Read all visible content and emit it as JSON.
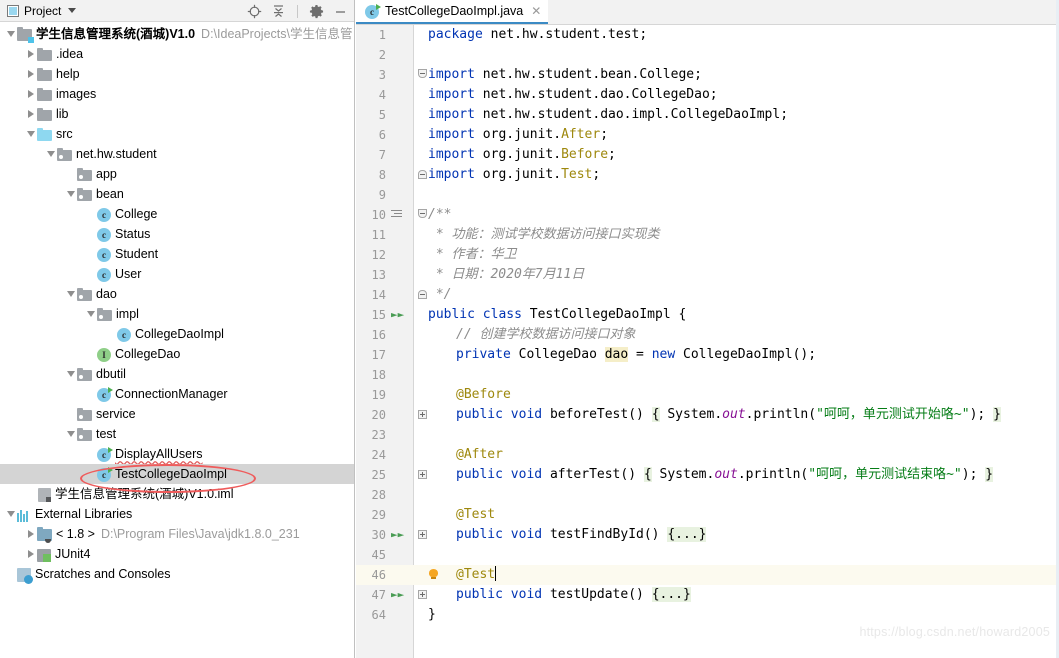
{
  "panel": {
    "title": "Project",
    "icons": [
      "project-icon",
      "chevron-down-icon",
      "locate-icon",
      "collapse-all-icon",
      "settings-gear-icon",
      "minimize-icon"
    ]
  },
  "tree": [
    {
      "label": "学生信息管理系统(酒城)V1.0",
      "sub": "D:\\IdeaProjects\\学生信息管",
      "indent": 0,
      "arrow": "open",
      "icon": "module-folder",
      "bold": true,
      "name": "tree-item-project-root"
    },
    {
      "label": ".idea",
      "indent": 1,
      "arrow": "closed",
      "icon": "folder",
      "name": "tree-item-idea"
    },
    {
      "label": "help",
      "indent": 1,
      "arrow": "closed",
      "icon": "folder",
      "name": "tree-item-help"
    },
    {
      "label": "images",
      "indent": 1,
      "arrow": "closed",
      "icon": "folder",
      "name": "tree-item-images"
    },
    {
      "label": "lib",
      "indent": 1,
      "arrow": "closed",
      "icon": "folder",
      "name": "tree-item-lib"
    },
    {
      "label": "src",
      "indent": 1,
      "arrow": "open",
      "icon": "source-folder",
      "name": "tree-item-src"
    },
    {
      "label": "net.hw.student",
      "indent": 2,
      "arrow": "open",
      "icon": "package",
      "name": "tree-item-package-net-hw-student"
    },
    {
      "label": "app",
      "indent": 3,
      "arrow": "none",
      "icon": "package",
      "name": "tree-item-package-app"
    },
    {
      "label": "bean",
      "indent": 3,
      "arrow": "open",
      "icon": "package",
      "name": "tree-item-package-bean"
    },
    {
      "label": "College",
      "indent": 4,
      "arrow": "none",
      "icon": "class",
      "name": "tree-item-class-college"
    },
    {
      "label": "Status",
      "indent": 4,
      "arrow": "none",
      "icon": "class",
      "name": "tree-item-class-status"
    },
    {
      "label": "Student",
      "indent": 4,
      "arrow": "none",
      "icon": "class",
      "name": "tree-item-class-student"
    },
    {
      "label": "User",
      "indent": 4,
      "arrow": "none",
      "icon": "class",
      "name": "tree-item-class-user"
    },
    {
      "label": "dao",
      "indent": 3,
      "arrow": "open",
      "icon": "package",
      "name": "tree-item-package-dao"
    },
    {
      "label": "impl",
      "indent": 4,
      "arrow": "open",
      "icon": "package",
      "name": "tree-item-package-impl"
    },
    {
      "label": "CollegeDaoImpl",
      "indent": 5,
      "arrow": "none",
      "icon": "class",
      "name": "tree-item-class-collegedaoimpl"
    },
    {
      "label": "CollegeDao",
      "indent": 4,
      "arrow": "none",
      "icon": "interface",
      "name": "tree-item-interface-collegedao"
    },
    {
      "label": "dbutil",
      "indent": 3,
      "arrow": "open",
      "icon": "package",
      "name": "tree-item-package-dbutil"
    },
    {
      "label": "ConnectionManager",
      "indent": 4,
      "arrow": "none",
      "icon": "class-runnable",
      "name": "tree-item-class-connectionmanager"
    },
    {
      "label": "service",
      "indent": 3,
      "arrow": "none",
      "icon": "package",
      "name": "tree-item-package-service"
    },
    {
      "label": "test",
      "indent": 3,
      "arrow": "open",
      "icon": "package",
      "name": "tree-item-package-test"
    },
    {
      "label": "DisplayAllUsers",
      "indent": 4,
      "arrow": "none",
      "icon": "class-runnable",
      "error": true,
      "name": "tree-item-class-displayallusers"
    },
    {
      "label": "TestCollegeDaoImpl",
      "indent": 4,
      "arrow": "none",
      "icon": "class-runnable",
      "selected": true,
      "name": "tree-item-class-testcollegedaoimpl"
    },
    {
      "label": "学生信息管理系统(酒城)V1.0.iml",
      "indent": 1,
      "arrow": "none",
      "icon": "iml",
      "name": "tree-item-iml-file"
    },
    {
      "label": "External Libraries",
      "indent": 0,
      "arrow": "open",
      "icon": "external-libraries",
      "name": "tree-item-external-libraries"
    },
    {
      "label": "< 1.8 >",
      "sub": "D:\\Program Files\\Java\\jdk1.8.0_231",
      "indent": 1,
      "arrow": "closed",
      "icon": "jdk",
      "name": "tree-item-jdk"
    },
    {
      "label": "JUnit4",
      "indent": 1,
      "arrow": "closed",
      "icon": "junit",
      "name": "tree-item-junit4"
    },
    {
      "label": "Scratches and Consoles",
      "indent": 0,
      "arrow": "none",
      "icon": "scratches",
      "name": "tree-item-scratches-and-consoles"
    }
  ],
  "editor": {
    "tab": {
      "label": "TestCollegeDaoImpl.java",
      "icon": "java-class-runnable-icon",
      "close": "✕"
    },
    "watermark": "https://blog.csdn.net/howard2005",
    "lines": [
      {
        "n": "1",
        "indent": 0,
        "tokens": [
          {
            "t": "package ",
            "c": "kw"
          },
          {
            "t": "net.hw.student.test;",
            "c": "ident"
          }
        ]
      },
      {
        "n": "2",
        "indent": 0,
        "tokens": []
      },
      {
        "n": "3",
        "indent": 0,
        "fold": "arrowdown",
        "tokens": [
          {
            "t": "import ",
            "c": "kw"
          },
          {
            "t": "net.hw.student.bean.College;",
            "c": "ident"
          }
        ]
      },
      {
        "n": "4",
        "indent": 0,
        "tokens": [
          {
            "t": "import ",
            "c": "kw"
          },
          {
            "t": "net.hw.student.dao.CollegeDao;",
            "c": "ident"
          }
        ]
      },
      {
        "n": "5",
        "indent": 0,
        "tokens": [
          {
            "t": "import ",
            "c": "kw"
          },
          {
            "t": "net.hw.student.dao.impl.CollegeDaoImpl;",
            "c": "ident"
          }
        ]
      },
      {
        "n": "6",
        "indent": 0,
        "tokens": [
          {
            "t": "import ",
            "c": "kw"
          },
          {
            "t": "org.junit.",
            "c": "ident"
          },
          {
            "t": "After",
            "c": "cls"
          },
          {
            "t": ";",
            "c": "ident"
          }
        ]
      },
      {
        "n": "7",
        "indent": 0,
        "tokens": [
          {
            "t": "import ",
            "c": "kw"
          },
          {
            "t": "org.junit.",
            "c": "ident"
          },
          {
            "t": "Before",
            "c": "cls"
          },
          {
            "t": ";",
            "c": "ident"
          }
        ]
      },
      {
        "n": "8",
        "indent": 0,
        "fold": "arrowup",
        "tokens": [
          {
            "t": "import ",
            "c": "kw"
          },
          {
            "t": "org.junit.",
            "c": "ident"
          },
          {
            "t": "Test",
            "c": "cls"
          },
          {
            "t": ";",
            "c": "ident"
          }
        ]
      },
      {
        "n": "9",
        "indent": 0,
        "tokens": []
      },
      {
        "n": "10",
        "indent": 0,
        "fold": "arrowdown",
        "docicon": true,
        "tokens": [
          {
            "t": "/**",
            "c": "cmt"
          }
        ]
      },
      {
        "n": "11",
        "indent": 0,
        "tokens": [
          {
            "t": " * 功能：测试学校数据访问接口实现类",
            "c": "cmt"
          }
        ]
      },
      {
        "n": "12",
        "indent": 0,
        "tokens": [
          {
            "t": " * 作者：华卫",
            "c": "cmt"
          }
        ]
      },
      {
        "n": "13",
        "indent": 0,
        "tokens": [
          {
            "t": " * 日期：2020年7月11日",
            "c": "cmt"
          }
        ]
      },
      {
        "n": "14",
        "indent": 0,
        "fold": "arrowup",
        "tokens": [
          {
            "t": " */",
            "c": "cmt"
          }
        ]
      },
      {
        "n": "15",
        "indent": 0,
        "run": true,
        "tokens": [
          {
            "t": "public ",
            "c": "kw"
          },
          {
            "t": "class ",
            "c": "kw"
          },
          {
            "t": "TestCollegeDaoImpl ",
            "c": "ident"
          },
          {
            "t": "{",
            "c": "ident"
          }
        ]
      },
      {
        "n": "16",
        "indent": 1,
        "tokens": [
          {
            "t": "// 创建学校数据访问接口对象",
            "c": "cmt"
          }
        ]
      },
      {
        "n": "17",
        "indent": 1,
        "tokens": [
          {
            "t": "private ",
            "c": "kw"
          },
          {
            "t": "CollegeDao ",
            "c": "ident"
          },
          {
            "t": "dao",
            "c": "fld"
          },
          {
            "t": " = ",
            "c": "ident"
          },
          {
            "t": "new ",
            "c": "kw"
          },
          {
            "t": "CollegeDaoImpl();",
            "c": "ident"
          }
        ]
      },
      {
        "n": "18",
        "indent": 0,
        "tokens": []
      },
      {
        "n": "19",
        "indent": 1,
        "tokens": [
          {
            "t": "@Before",
            "c": "anno"
          }
        ]
      },
      {
        "n": "20",
        "indent": 1,
        "fold": "sq",
        "tokens": [
          {
            "t": "public ",
            "c": "kw"
          },
          {
            "t": "void ",
            "c": "kw"
          },
          {
            "t": "beforeTest",
            "c": "mth"
          },
          {
            "t": "() ",
            "c": "ident"
          },
          {
            "t": "{",
            "c": "brace-hl"
          },
          {
            "t": " System.",
            "c": "ident"
          },
          {
            "t": "out",
            "c": "stat"
          },
          {
            "t": ".println(",
            "c": "ident"
          },
          {
            "t": "\"呵呵，单元测试开始咯~\"",
            "c": "str"
          },
          {
            "t": "); ",
            "c": "ident"
          },
          {
            "t": "}",
            "c": "brace-hl"
          }
        ]
      },
      {
        "n": "23",
        "indent": 0,
        "tokens": []
      },
      {
        "n": "24",
        "indent": 1,
        "tokens": [
          {
            "t": "@After",
            "c": "anno"
          }
        ]
      },
      {
        "n": "25",
        "indent": 1,
        "fold": "sq",
        "tokens": [
          {
            "t": "public ",
            "c": "kw"
          },
          {
            "t": "void ",
            "c": "kw"
          },
          {
            "t": "afterTest",
            "c": "mth"
          },
          {
            "t": "() ",
            "c": "ident"
          },
          {
            "t": "{",
            "c": "brace-hl"
          },
          {
            "t": " System.",
            "c": "ident"
          },
          {
            "t": "out",
            "c": "stat"
          },
          {
            "t": ".println(",
            "c": "ident"
          },
          {
            "t": "\"呵呵，单元测试结束咯~\"",
            "c": "str"
          },
          {
            "t": "); ",
            "c": "ident"
          },
          {
            "t": "}",
            "c": "brace-hl"
          }
        ]
      },
      {
        "n": "28",
        "indent": 0,
        "tokens": []
      },
      {
        "n": "29",
        "indent": 1,
        "tokens": [
          {
            "t": "@Test",
            "c": "anno"
          }
        ]
      },
      {
        "n": "30",
        "indent": 1,
        "run": true,
        "fold": "sq",
        "tokens": [
          {
            "t": "public ",
            "c": "kw"
          },
          {
            "t": "void ",
            "c": "kw"
          },
          {
            "t": "testFindById",
            "c": "mth"
          },
          {
            "t": "() ",
            "c": "ident"
          },
          {
            "t": "{...}",
            "c": "brace-hl"
          }
        ]
      },
      {
        "n": "45",
        "indent": 0,
        "tokens": []
      },
      {
        "n": "46",
        "indent": 1,
        "current": true,
        "bulb": true,
        "caret": true,
        "tokens": [
          {
            "t": "@Test",
            "c": "anno"
          }
        ]
      },
      {
        "n": "47",
        "indent": 1,
        "run": true,
        "fold": "sq",
        "tokens": [
          {
            "t": "public ",
            "c": "kw"
          },
          {
            "t": "void ",
            "c": "kw"
          },
          {
            "t": "testUpdate",
            "c": "mth"
          },
          {
            "t": "() ",
            "c": "ident"
          },
          {
            "t": "{...}",
            "c": "brace-hl"
          }
        ]
      },
      {
        "n": "64",
        "indent": 0,
        "tokens": [
          {
            "t": "}",
            "c": "ident"
          }
        ]
      }
    ]
  },
  "colors": {
    "keyword": "#0033b3",
    "string": "#067d17",
    "annotation": "#9e880d",
    "comment": "#8c8c8c",
    "static_field": "#871094",
    "tab_underline": "#3b8ac4",
    "annotation_ellipse": "#ef5b5b",
    "selection": "#d4d4d4",
    "current_line": "#fcfaef"
  }
}
